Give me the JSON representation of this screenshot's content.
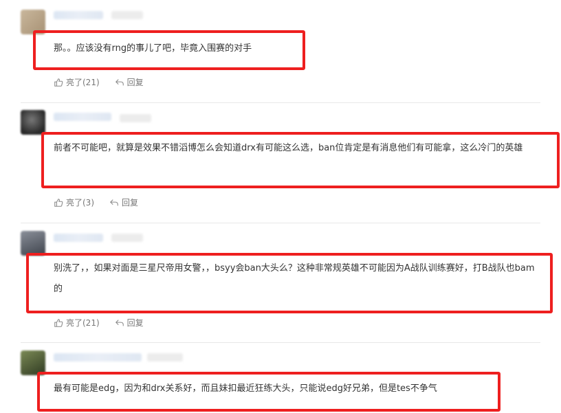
{
  "comments": [
    {
      "text": "那。。应该没有rng的事儿了吧，毕竟入围赛的对手",
      "like_label": "亮了(21)",
      "reply_label": "回复",
      "avatar_color": "#c9b79c"
    },
    {
      "text": "前者不可能吧，就算是效果不错滔博怎么会知道drx有可能这么选，ban位肯定是有消息他们有可能拿，这么冷门的英雄",
      "like_label": "亮了(3)",
      "reply_label": "回复",
      "avatar_color": "#3a3a3a"
    },
    {
      "text": "别洗了，，如果对面是三星尺帝用女警，，bsyy会ban大头么？这种非常规英雄不可能因为A战队训练赛好，打B战队也bam的",
      "like_label": "亮了(21)",
      "reply_label": "回复",
      "avatar_color": "#6b6f7a"
    },
    {
      "text": "最有可能是edg，因为和drx关系好，而且妹扣最近狂练大头，只能说edg好兄弟，但是tes不争气",
      "like_label": "",
      "reply_label": "",
      "avatar_color": "#5a6b3f"
    }
  ],
  "colors": {
    "highlight_border": "#ee1f1f",
    "text": "#333333",
    "action_text": "#777777"
  }
}
